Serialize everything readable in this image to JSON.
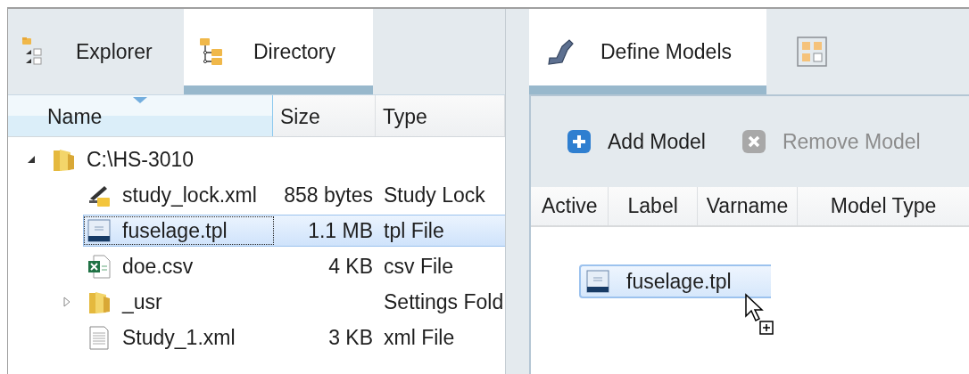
{
  "left_panel": {
    "tabs": [
      {
        "label": "Explorer",
        "kind": "tree-list",
        "selected": false
      },
      {
        "label": "Directory",
        "kind": "folder-tree",
        "selected": true
      }
    ],
    "columns": [
      {
        "label": "Name",
        "sorted": true
      },
      {
        "label": "Size",
        "sorted": false
      },
      {
        "label": "Type",
        "sorted": false
      }
    ],
    "tree": [
      {
        "name": "C:\\HS-3010",
        "kind": "folder",
        "expanded": true,
        "selected": false,
        "children": [
          {
            "name": "study_lock.xml",
            "kind": "lock",
            "size": "858 bytes",
            "type": "Study Lock",
            "selected": false
          },
          {
            "name": "fuselage.tpl",
            "kind": "template",
            "size": "1.1 MB",
            "type": "tpl File",
            "selected": true
          },
          {
            "name": "doe.csv",
            "kind": "spreadsheet",
            "size": "4 KB",
            "type": "csv File",
            "selected": false
          },
          {
            "name": "_usr",
            "kind": "folder",
            "expanded": false,
            "type": "Settings Fold",
            "selected": false
          },
          {
            "name": "Study_1.xml",
            "kind": "document",
            "size": "3 KB",
            "type": "xml File",
            "selected": false
          }
        ]
      }
    ]
  },
  "right_panel": {
    "tabs": [
      {
        "label": "Define Models",
        "kind": "pipe",
        "selected": true
      },
      {
        "kind": "grid",
        "selected": false
      }
    ],
    "toolbar": [
      {
        "label": "Add Model",
        "kind": "add",
        "disabled": false
      },
      {
        "label": "Remove Model",
        "kind": "remove",
        "disabled": true
      }
    ],
    "columns": [
      {
        "label": "Active"
      },
      {
        "label": "Label"
      },
      {
        "label": "Varname"
      },
      {
        "label": "Model Type"
      }
    ],
    "drag_item": {
      "label": "fuselage.tpl",
      "kind": "template"
    }
  }
}
